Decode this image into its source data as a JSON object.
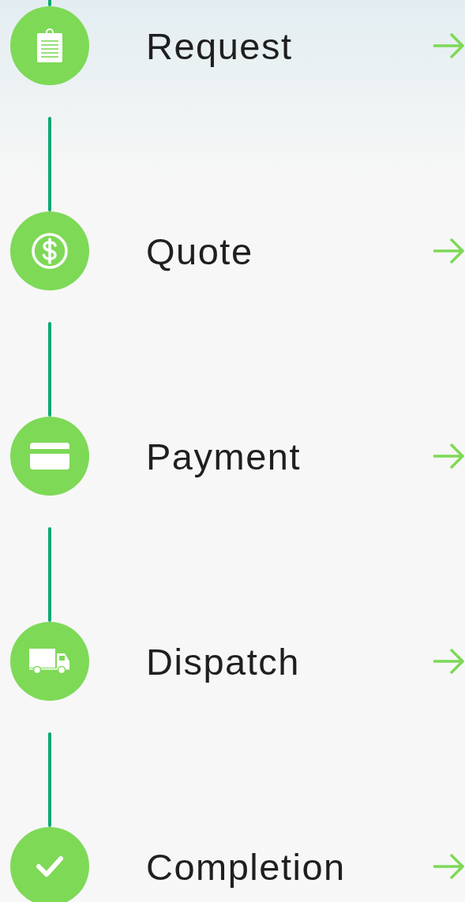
{
  "steps": [
    {
      "label": "Request",
      "kind": "clipboard"
    },
    {
      "label": "Quote",
      "kind": "dollar"
    },
    {
      "label": "Payment",
      "kind": "card"
    },
    {
      "label": "Dispatch",
      "kind": "truck"
    },
    {
      "label": "Completion",
      "kind": "check"
    }
  ]
}
